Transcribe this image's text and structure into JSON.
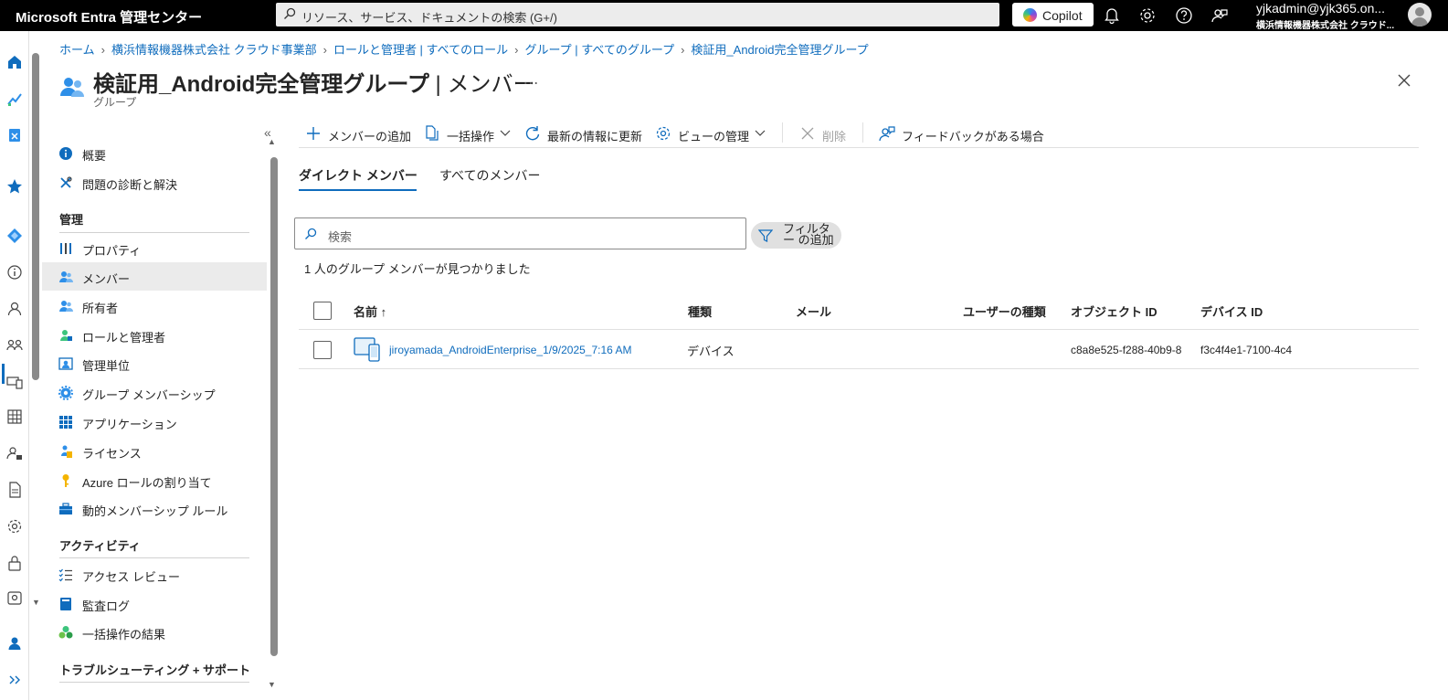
{
  "topbar": {
    "app_title": "Microsoft Entra 管理センター",
    "search_placeholder": "リソース、サービス、ドキュメントの検索 (G+/)",
    "copilot_label": "Copilot",
    "user_name": "yjkadmin@yjk365.on...",
    "user_tenant": "横浜情報機器株式会社 クラウド..."
  },
  "breadcrumb": [
    "ホーム",
    "横浜情報機器株式会社 クラウド事業部",
    "ロールと管理者 | すべてのロール",
    "グループ | すべてのグループ",
    "検証用_Android完全管理グループ"
  ],
  "page": {
    "title_main": "検証用_Android完全管理グループ",
    "title_sep": " | ",
    "title_section": "メンバー",
    "more": "…",
    "subtitle": "グループ"
  },
  "sidenav": {
    "collapse": "«",
    "items_top": [
      {
        "label": "概要",
        "icon": "info-icon"
      },
      {
        "label": "問題の診断と解決",
        "icon": "wrench-icon"
      }
    ],
    "section_manage": "管理",
    "items_manage": [
      {
        "label": "プロパティ",
        "icon": "properties-icon"
      },
      {
        "label": "メンバー",
        "icon": "members-icon"
      },
      {
        "label": "所有者",
        "icon": "owners-icon"
      },
      {
        "label": "ロールと管理者",
        "icon": "roles-icon"
      },
      {
        "label": "管理単位",
        "icon": "admin-unit-icon"
      },
      {
        "label": "グループ メンバーシップ",
        "icon": "gear-icon"
      },
      {
        "label": "アプリケーション",
        "icon": "apps-grid-icon"
      },
      {
        "label": "ライセンス",
        "icon": "license-icon"
      },
      {
        "label": "Azure ロールの割り当て",
        "icon": "key-icon"
      },
      {
        "label": "動的メンバーシップ ルール",
        "icon": "toolbox-icon"
      }
    ],
    "section_activity": "アクティビティ",
    "items_activity": [
      {
        "label": "アクセス レビュー",
        "icon": "checklist-icon"
      },
      {
        "label": "監査ログ",
        "icon": "log-book-icon"
      },
      {
        "label": "一括操作の結果",
        "icon": "bulk-results-icon"
      }
    ],
    "section_support": "トラブルシューティング + サポート"
  },
  "commands": {
    "add_member": "メンバーの追加",
    "bulk": "一括操作",
    "refresh": "最新の情報に更新",
    "manage_view": "ビューの管理",
    "delete": "削除",
    "feedback": "フィードバックがある場合"
  },
  "tabs": {
    "direct": "ダイレクト メンバー",
    "all": "すべてのメンバー"
  },
  "search": {
    "placeholder": "検索",
    "filter_label": "フィルター の追加",
    "result_count": "1 人のグループ メンバーが見つかりました"
  },
  "table": {
    "columns": [
      "名前 ↑",
      "種類",
      "メール",
      "ユーザーの種類",
      "オブジェクト ID",
      "デバイス ID"
    ],
    "rows": [
      {
        "name": "jiroyamada_AndroidEnterprise_1/9/2025_7:16 AM",
        "type": "デバイス",
        "mail": "",
        "user_type": "",
        "object_id": "c8a8e525-f288-40b9-8",
        "device_id": "f3c4f4e1-7100-4c4"
      }
    ]
  },
  "colors": {
    "accent": "#0f6cbd",
    "topbar_bg": "#000000",
    "active_nav_bg": "#ebebeb"
  }
}
